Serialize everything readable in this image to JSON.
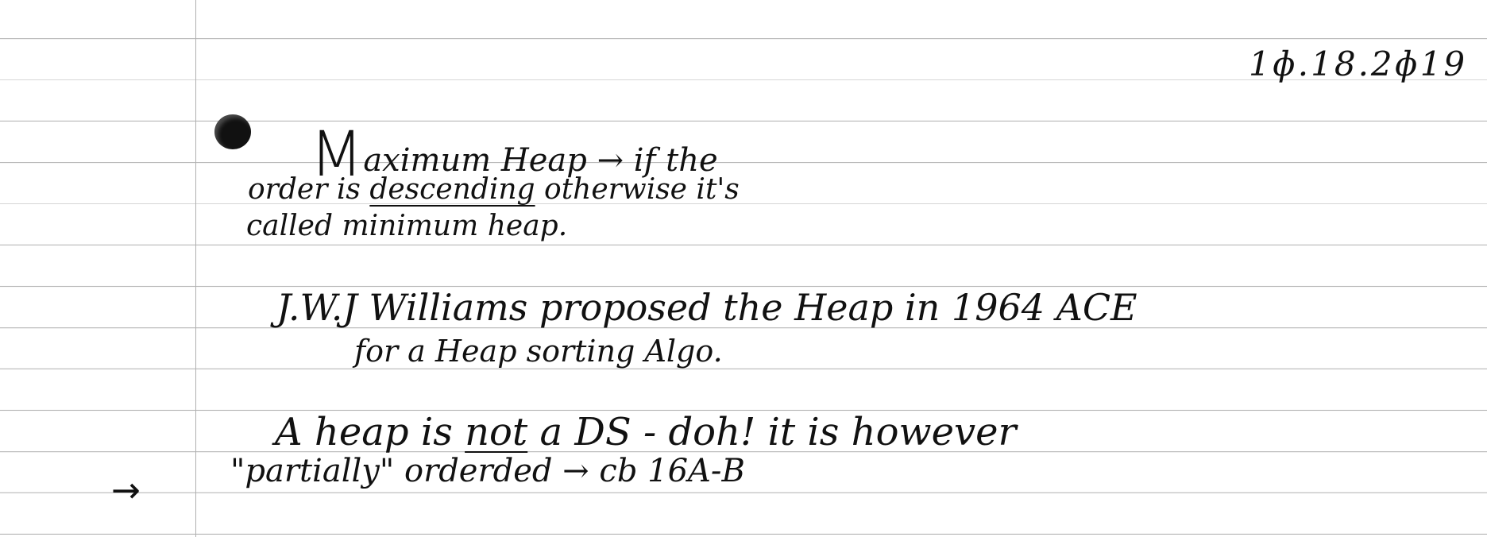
{
  "note": {
    "date": "1ɸ.18.2ɸ19",
    "heading_initial": "M",
    "heading_rest": "aximum  Heap  →  if  the",
    "line2": [
      "order    is    ",
      "descending",
      "    otherwise    it's"
    ],
    "line3": "called   minimum              heap.",
    "line4": "J.W.J  Williams  proposed  the  Heap  in  1964  ACE",
    "line5": "for   a   Heap   sorting   Algo.",
    "line6": [
      "A   heap   is   ",
      "not",
      "   a   DS  - doh!   it  is  however"
    ],
    "line7": "\"partially\"   orderded   →   cb   16A-B",
    "margin_arrow": "→"
  }
}
